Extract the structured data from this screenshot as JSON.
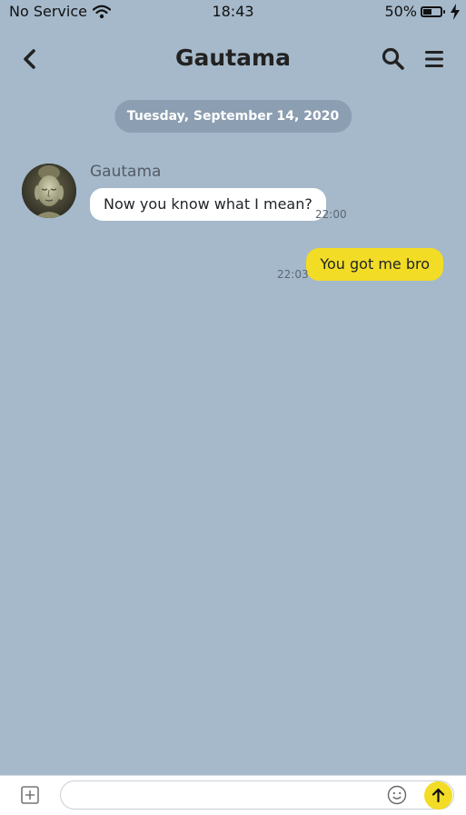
{
  "status_bar": {
    "carrier": "No Service",
    "time": "18:43",
    "battery_percent": "50%",
    "battery_level": 0.5,
    "icons": [
      "wifi-icon",
      "battery-icon",
      "charging-bolt-icon"
    ]
  },
  "header": {
    "title": "Gautama",
    "icons": [
      "back-chevron-icon",
      "search-icon",
      "menu-icon"
    ]
  },
  "chat": {
    "date_divider": "Tuesday, September 14, 2020",
    "messages": [
      {
        "direction": "incoming",
        "sender": "Gautama",
        "text": "Now you know what I mean?",
        "time": "22:00"
      },
      {
        "direction": "outgoing",
        "text": "You got me bro",
        "time": "22:03"
      }
    ]
  },
  "composer": {
    "input_value": "",
    "icons": [
      "add-icon",
      "emoji-icon",
      "send-arrow-icon"
    ]
  },
  "colors": {
    "background": "#a5b9ca",
    "incoming_bubble": "#ffffff",
    "outgoing_bubble": "#f2dc25",
    "date_pill": "#8c9eb1"
  }
}
